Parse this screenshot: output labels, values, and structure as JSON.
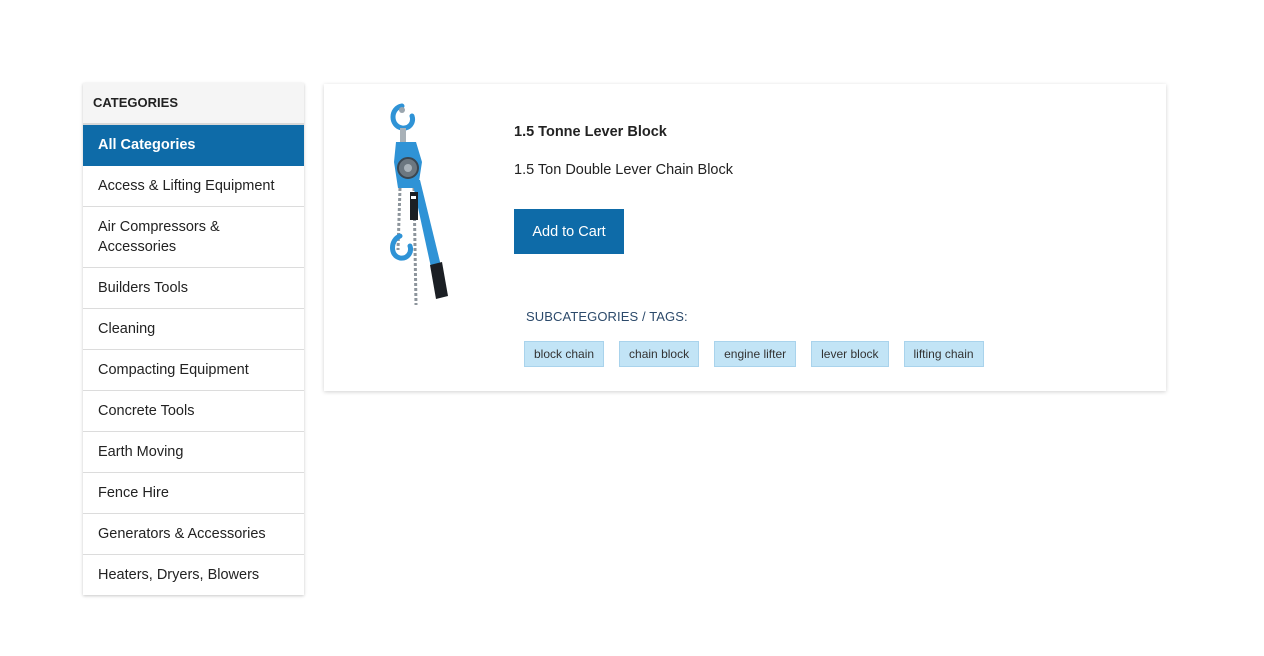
{
  "sidebar": {
    "heading": "CATEGORIES",
    "items": [
      {
        "label": "All Categories"
      },
      {
        "label": "Access & Lifting Equipment"
      },
      {
        "label": "Air Compressors & Accessories"
      },
      {
        "label": "Builders Tools"
      },
      {
        "label": "Cleaning"
      },
      {
        "label": "Compacting Equipment"
      },
      {
        "label": "Concrete Tools"
      },
      {
        "label": "Earth Moving"
      },
      {
        "label": "Fence Hire"
      },
      {
        "label": "Generators & Accessories"
      },
      {
        "label": "Heaters, Dryers, Blowers"
      }
    ],
    "active_index": 0
  },
  "product": {
    "title": "1.5 Tonne Lever Block",
    "description": "1.5 Ton Double Lever Chain Block",
    "add_to_cart_label": "Add to Cart",
    "tags_heading": "SUBCATEGORIES / TAGS",
    "tags_heading_suffix": ":",
    "tags": [
      "block chain",
      "chain block",
      "engine lifter",
      "lever block",
      "lifting chain"
    ],
    "image_icon": "lever-block-image"
  },
  "colors": {
    "accent": "#0e6ba8",
    "tag_bg": "#c2e4f6",
    "tag_border": "#a9d3ec",
    "heading_color": "#2c4a6b"
  }
}
